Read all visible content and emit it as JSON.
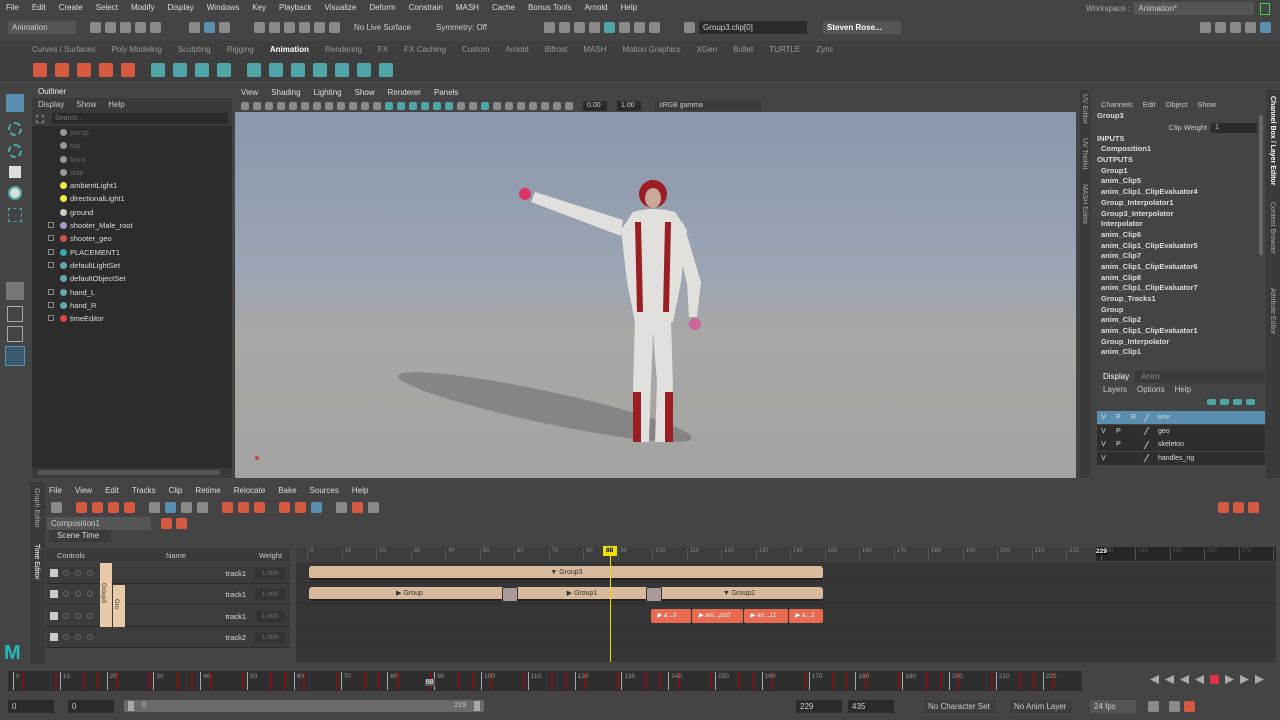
{
  "menu": [
    "File",
    "Edit",
    "Create",
    "Select",
    "Modify",
    "Display",
    "Windows",
    "Key",
    "Playback",
    "Visualize",
    "Deform",
    "Constrain",
    "MASH",
    "Cache",
    "Bonus Tools",
    "Arnold",
    "Help"
  ],
  "workspace": {
    "label": "Workspace :",
    "value": "Animation*"
  },
  "status": {
    "mode": "Animation",
    "live_surface": "No Live Surface",
    "symmetry": "Symmetry: Off",
    "input": "Group3.clip[0]",
    "user": "Steven Rose..."
  },
  "shelf_tabs": [
    "Curves / Surfaces",
    "Poly Modeling",
    "Sculpting",
    "Rigging",
    "Animation",
    "Rendering",
    "FX",
    "FX Caching",
    "Custom",
    "Arnold",
    "Bifrost",
    "MASH",
    "Motion Graphics",
    "XGen",
    "Bullet",
    "TURTLE",
    "Zync"
  ],
  "shelf_active": "Animation",
  "outliner": {
    "title": "Outliner",
    "menu": [
      "Display",
      "Show",
      "Help"
    ],
    "search_placeholder": "Search...",
    "items": [
      {
        "name": "persp",
        "dim": true
      },
      {
        "name": "top",
        "dim": true
      },
      {
        "name": "front",
        "dim": true
      },
      {
        "name": "side",
        "dim": true
      },
      {
        "name": "ambientLight1"
      },
      {
        "name": "directionalLight1"
      },
      {
        "name": "ground"
      },
      {
        "name": "shooter_Male_root",
        "exp": true
      },
      {
        "name": "shooter_geo",
        "exp": true
      },
      {
        "name": "PLACEMENT1",
        "exp": true
      },
      {
        "name": "defaultLightSet",
        "exp": true
      },
      {
        "name": "defaultObjectSet"
      },
      {
        "name": "hand_L",
        "exp": true
      },
      {
        "name": "hand_R",
        "exp": true
      },
      {
        "name": "timeEditor",
        "exp": true
      }
    ]
  },
  "viewport": {
    "menu": [
      "View",
      "Shading",
      "Lighting",
      "Show",
      "Renderer",
      "Panels"
    ],
    "exposure": "0.00",
    "gamma": "1.00",
    "colorspace": "sRGB gamma"
  },
  "channel_box": {
    "menu": [
      "Channels",
      "Edit",
      "Object",
      "Show"
    ],
    "object": "Group3",
    "attr_label": "Clip Weight",
    "attr_value": "1",
    "inputs_label": "INPUTS",
    "inputs": [
      "Composition1"
    ],
    "outputs_label": "OUTPUTS",
    "outputs": [
      "Group1",
      "anim_Clip5",
      "anim_Clip1_ClipEvaluator4",
      "Group_Interpolator1",
      "Group3_Interpolator",
      "Interpolator",
      "anim_Clip6",
      "anim_Clip1_ClipEvaluator5",
      "anim_Clip7",
      "anim_Clip1_ClipEvaluator6",
      "anim_Clip8",
      "anim_Clip1_ClipEvaluator7",
      "Group_Tracks1",
      "Group",
      "anim_Clip2",
      "anim_Clip1_ClipEvaluator1",
      "Group_Interpolator",
      "anim_Clip1"
    ]
  },
  "layer_editor": {
    "tabs": [
      "Display",
      "Anim"
    ],
    "menu": [
      "Layers",
      "Options",
      "Help"
    ],
    "layers": [
      {
        "v": "V",
        "p": "P",
        "r": "R",
        "name": "env",
        "selected": true
      },
      {
        "v": "V",
        "p": "P",
        "r": "",
        "name": "geo"
      },
      {
        "v": "V",
        "p": "P",
        "r": "",
        "name": "skeleton"
      },
      {
        "v": "V",
        "p": "",
        "r": "",
        "name": "handles_rig"
      }
    ]
  },
  "side_tabs": {
    "right": [
      "Channel Box / Layer Editor",
      "Content Browser",
      "Attribute Editor"
    ],
    "mid": [
      "UV Editor",
      "UV Toolkit",
      "MASH Editor"
    ],
    "left": [
      "Graph Editor",
      "Time Editor"
    ]
  },
  "time_editor": {
    "menu": [
      "File",
      "View",
      "Edit",
      "Tracks",
      "Clip",
      "Retime",
      "Relocate",
      "Bake",
      "Sources",
      "Help"
    ],
    "composition": "Composition1",
    "scene_time": "Scene Time",
    "headers": {
      "controls": "Controls",
      "name": "Name",
      "weight": "Weight"
    },
    "tracks": [
      {
        "name": "track1",
        "weight": "1.000"
      },
      {
        "name": "track1",
        "weight": "1.000"
      },
      {
        "name": "track1",
        "weight": "1.000"
      },
      {
        "name": "track2",
        "weight": "1.000"
      }
    ],
    "group_labels": [
      "Group3",
      "Gro"
    ],
    "ruler": {
      "start": 0,
      "end": 280,
      "step": 10,
      "playback_end": 229
    },
    "current_frame": 88,
    "clips": [
      {
        "label": "Group3",
        "start": 1,
        "end": 150,
        "row": 0,
        "icon": "▼"
      },
      {
        "label": "Group",
        "start": 1,
        "end": 59,
        "row": 1,
        "icon": "▶"
      },
      {
        "label": "Group1",
        "start": 59,
        "end": 101,
        "row": 1,
        "icon": "▶"
      },
      {
        "label": "Group2",
        "start": 101,
        "end": 150,
        "row": 1,
        "icon": "▼"
      }
    ],
    "anim_clips": [
      {
        "label": "a...9",
        "start": 100,
        "end": 112
      },
      {
        "label": "ani...p10",
        "start": 112,
        "end": 127
      },
      {
        "label": "an...11",
        "start": 127,
        "end": 140
      },
      {
        "label": "a...2",
        "start": 140,
        "end": 150
      }
    ]
  },
  "time_slider": {
    "start": 0,
    "end": 229,
    "step": 10,
    "current": 88
  },
  "range": {
    "start": "0",
    "min": "0",
    "slider_start": "0",
    "slider_end": "229",
    "end": "229",
    "max": "435",
    "char_set": "No Character Set",
    "anim_layer": "No Anim Layer",
    "fps": "24 fps"
  },
  "colors": {
    "accent": "#5a8fb0",
    "clip": "#d9b99b",
    "anim_clip": "#e86a50",
    "playhead": "#f0e000",
    "key": "#8b1a1a"
  }
}
